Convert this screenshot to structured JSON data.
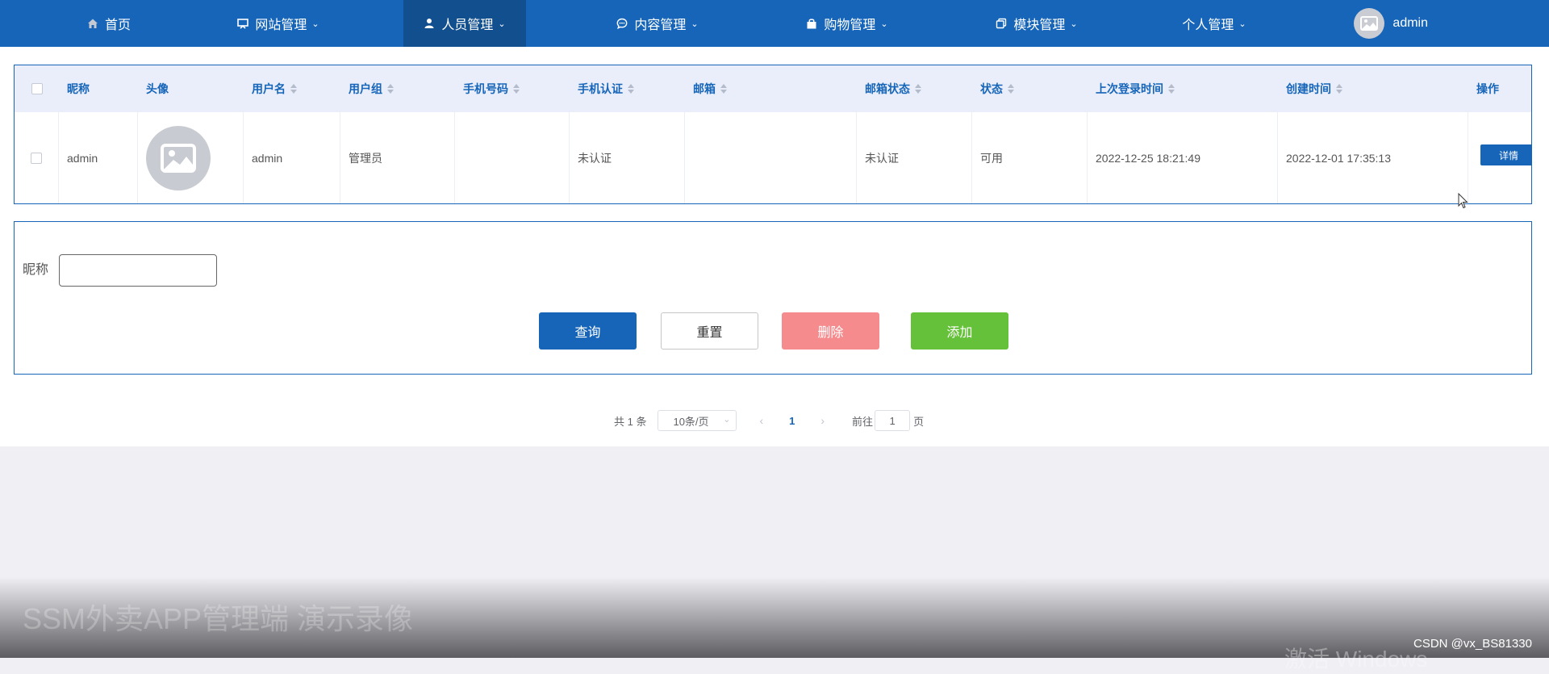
{
  "nav": {
    "items": [
      {
        "label": "首页",
        "icon": "home-icon"
      },
      {
        "label": "网站管理",
        "icon": "monitor-icon"
      },
      {
        "label": "人员管理",
        "icon": "person-icon"
      },
      {
        "label": "内容管理",
        "icon": "chat-icon"
      },
      {
        "label": "购物管理",
        "icon": "bag-icon"
      },
      {
        "label": "模块管理",
        "icon": "copy-icon"
      },
      {
        "label": "个人管理",
        "icon": ""
      }
    ],
    "active_index": 2,
    "user_name": "admin"
  },
  "table": {
    "columns": [
      "昵称",
      "头像",
      "用户名",
      "用户组",
      "手机号码",
      "手机认证",
      "邮箱",
      "邮箱状态",
      "状态",
      "上次登录时间",
      "创建时间",
      "操作"
    ],
    "rows": [
      {
        "nickname": "admin",
        "username": "admin",
        "group": "管理员",
        "phone": "",
        "phone_auth": "未认证",
        "email": "",
        "email_status": "未认证",
        "status": "可用",
        "last_login": "2022-12-25 18:21:49",
        "created": "2022-12-01 17:35:13",
        "action": "详情"
      }
    ]
  },
  "search": {
    "label": "昵称",
    "value": "",
    "buttons": {
      "query": "查询",
      "reset": "重置",
      "delete": "删除",
      "add": "添加"
    }
  },
  "pagination": {
    "total_text": "共 1 条",
    "page_size": "10条/页",
    "current_page": "1",
    "goto_label": "前往",
    "goto_value": "1",
    "page_suffix": "页"
  },
  "overlay": {
    "video_title": "SSM外卖APP管理端 演示录像",
    "windows_watermark": "激活 Windows",
    "csdn_watermark": "CSDN @vx_BS81330"
  },
  "colors": {
    "primary": "#1665b8",
    "danger": "#f68b8d",
    "success": "#66c13a"
  }
}
